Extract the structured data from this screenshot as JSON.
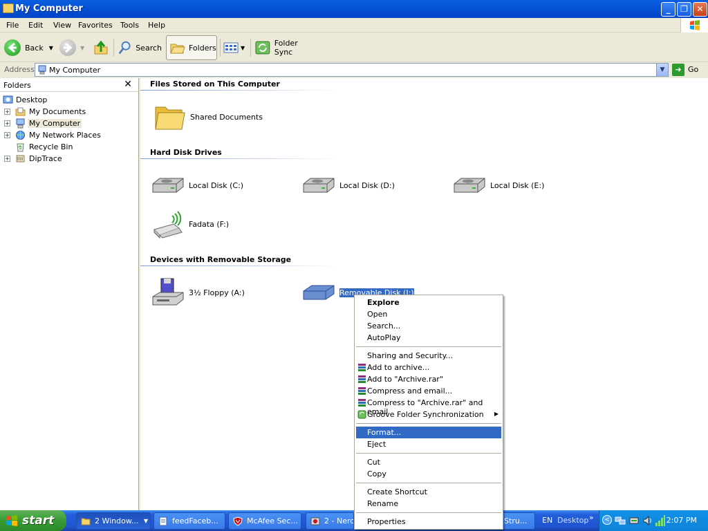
{
  "window": {
    "title": "My Computer",
    "controls": {
      "minimize": "_",
      "maximize": "❐",
      "close": "✕"
    }
  },
  "menubar": {
    "items": [
      {
        "label": "File"
      },
      {
        "label": "Edit"
      },
      {
        "label": "View"
      },
      {
        "label": "Favorites"
      },
      {
        "label": "Tools"
      },
      {
        "label": "Help"
      }
    ]
  },
  "toolbar": {
    "back_label": "Back",
    "search_label": "Search",
    "folders_label": "Folders",
    "foldersync_label": "Folder Sync"
  },
  "address": {
    "label": "Address",
    "value": "My Computer",
    "go_label": "Go"
  },
  "folders_pane": {
    "title": "Folders",
    "close": "✕",
    "tree": [
      {
        "label": "Desktop",
        "expander": ""
      },
      {
        "label": "My Documents",
        "expander": "+"
      },
      {
        "label": "My Computer",
        "expander": "+"
      },
      {
        "label": "My Network Places",
        "expander": "+"
      },
      {
        "label": "Recycle Bin",
        "expander": ""
      },
      {
        "label": "DipTrace",
        "expander": "+"
      }
    ]
  },
  "content": {
    "groups": [
      {
        "title": "Files Stored on This Computer"
      },
      {
        "title": "Hard Disk Drives"
      },
      {
        "title": "Devices with Removable Storage"
      }
    ],
    "items": {
      "shared_documents": "Shared Documents",
      "disk_c": "Local Disk (C:)",
      "disk_d": "Local Disk (D:)",
      "disk_e": "Local Disk (E:)",
      "fadata": "Fadata (F:)",
      "floppy": "3½ Floppy (A:)",
      "removable": "Removable Disk (I:)"
    }
  },
  "context_menu": {
    "items": [
      {
        "label": "Explore"
      },
      {
        "label": "Open"
      },
      {
        "label": "Search..."
      },
      {
        "label": "AutoPlay"
      },
      {
        "label": "Sharing and Security..."
      },
      {
        "label": "Add to archive..."
      },
      {
        "label": "Add to \"Archive.rar\""
      },
      {
        "label": "Compress and email..."
      },
      {
        "label": "Compress to \"Archive.rar\" and email"
      },
      {
        "label": "Groove Folder Synchronization"
      },
      {
        "label": "Format..."
      },
      {
        "label": "Eject"
      },
      {
        "label": "Cut"
      },
      {
        "label": "Copy"
      },
      {
        "label": "Create Shortcut"
      },
      {
        "label": "Rename"
      },
      {
        "label": "Properties"
      }
    ],
    "highlight_color": "#316ac5"
  },
  "taskbar": {
    "start_label": "start",
    "tasks": [
      {
        "label": "2 Window..."
      },
      {
        "label": "feedFaceb..."
      },
      {
        "label": "McAfee Sec..."
      },
      {
        "label": "2 - Nero ..."
      },
      {
        "label": "Stru..."
      }
    ],
    "language": "EN",
    "desktop_label": "Desktop",
    "chevron": "»",
    "clock": "2:07 PM"
  },
  "colors": {
    "titlebar": "#0653d8",
    "taskbar": "#245edb",
    "start": "#379a33",
    "selection": "#316ac5",
    "chrome": "#ece9d8"
  }
}
